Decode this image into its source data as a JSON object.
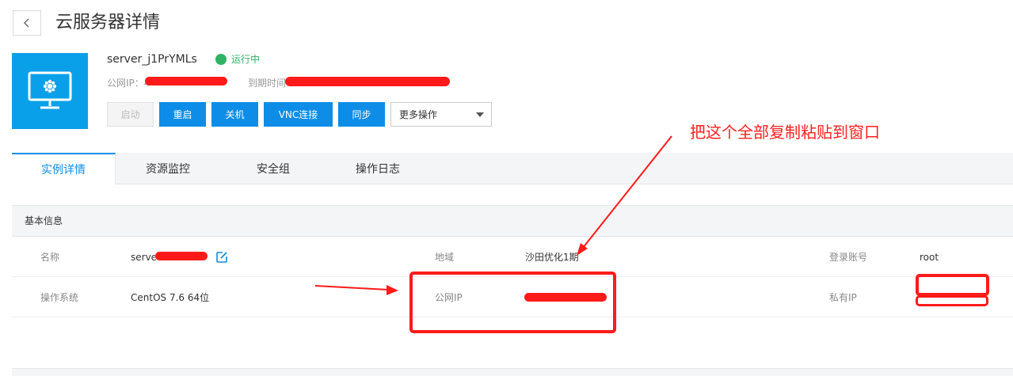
{
  "header": {
    "title": "云服务器详情"
  },
  "server": {
    "name": "server_j1PrYMLs",
    "status": "运行中",
    "public_ip_label": "公网IP：4",
    "expire_label": "到期时间"
  },
  "actions": {
    "start": "启动",
    "restart": "重启",
    "shutdown": "关机",
    "vnc": "VNC连接",
    "sync": "同步",
    "more": "更多操作"
  },
  "tabs": [
    {
      "label": "实例详情",
      "active": true
    },
    {
      "label": "资源监控",
      "active": false
    },
    {
      "label": "安全组",
      "active": false
    },
    {
      "label": "操作日志",
      "active": false
    }
  ],
  "basic_info": {
    "title": "基本信息",
    "name_label": "名称",
    "name_value": "serve",
    "region_label": "地域",
    "region_value": "沙田优化1期",
    "login_label": "登录账号",
    "login_value": "root",
    "os_label": "操作系统",
    "os_value": "CentOS 7.6 64位",
    "public_ip_label": "公网IP",
    "private_ip_label": "私有IP"
  },
  "annotation": {
    "text": "把这个全部复制粘贴到窗口"
  },
  "colors": {
    "accent": "#0d8de8",
    "status_green": "#2eb365",
    "annotation_red": "#ff1a1a"
  }
}
